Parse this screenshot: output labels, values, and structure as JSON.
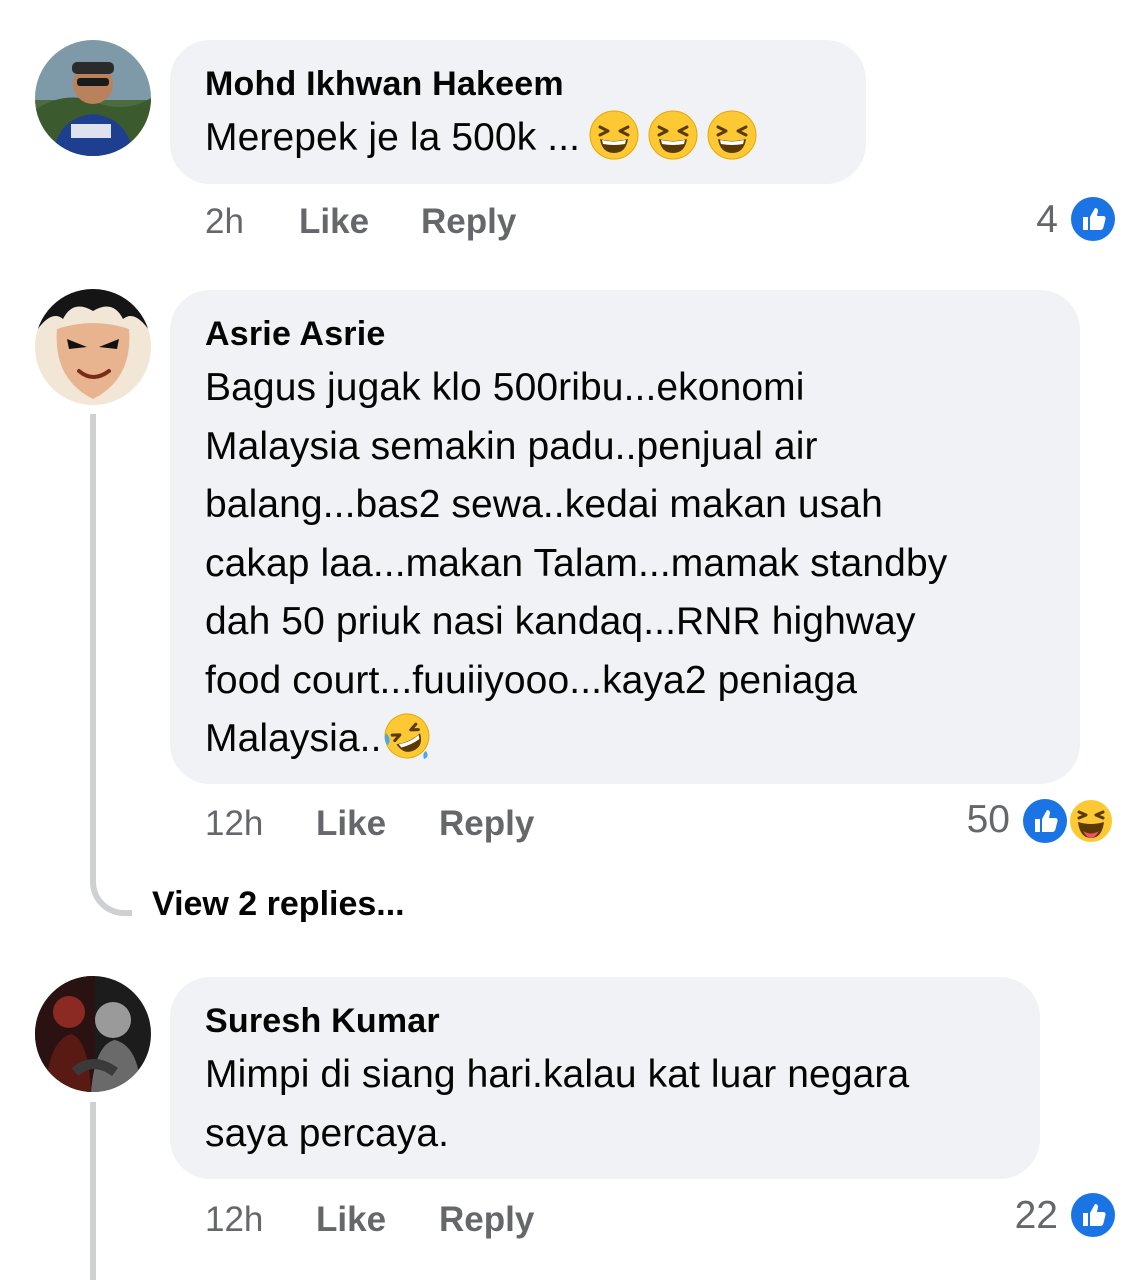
{
  "comments": [
    {
      "author": "Mohd Ikhwan Hakeem",
      "text": "Merepek je la 500k ...",
      "emojis": [
        "grinning-squinting-face",
        "grinning-squinting-face",
        "grinning-squinting-face"
      ],
      "time": "2h",
      "like_label": "Like",
      "reply_label": "Reply",
      "reaction_count": "4",
      "reactions": [
        "like"
      ]
    },
    {
      "author": "Asrie Asrie",
      "lines": [
        "Bagus jugak klo 500ribu...ekonomi",
        "Malaysia semakin padu..penjual air",
        "balang...bas2 sewa..kedai makan usah",
        "cakap laa...makan Talam...mamak standby",
        "dah 50 priuk nasi kandaq...RNR highway",
        "food court...fuuiiyooo...kaya2 peniaga",
        "Malaysia.."
      ],
      "emojis": [
        "rolling-on-floor-laughing"
      ],
      "time": "12h",
      "like_label": "Like",
      "reply_label": "Reply",
      "reaction_count": "50",
      "reactions": [
        "like",
        "haha"
      ],
      "view_replies": "View 2 replies..."
    },
    {
      "author": "Suresh Kumar",
      "lines": [
        "Mimpi di siang hari.kalau kat luar negara",
        "saya percaya."
      ],
      "time": "12h",
      "like_label": "Like",
      "reply_label": "Reply",
      "reaction_count": "22",
      "reactions": [
        "like"
      ]
    }
  ],
  "colors": {
    "bubble_bg": "#f0f2f5",
    "meta_text": "#65676b",
    "like_blue": "#1b74e4",
    "thread_line": "#ced0d4"
  }
}
